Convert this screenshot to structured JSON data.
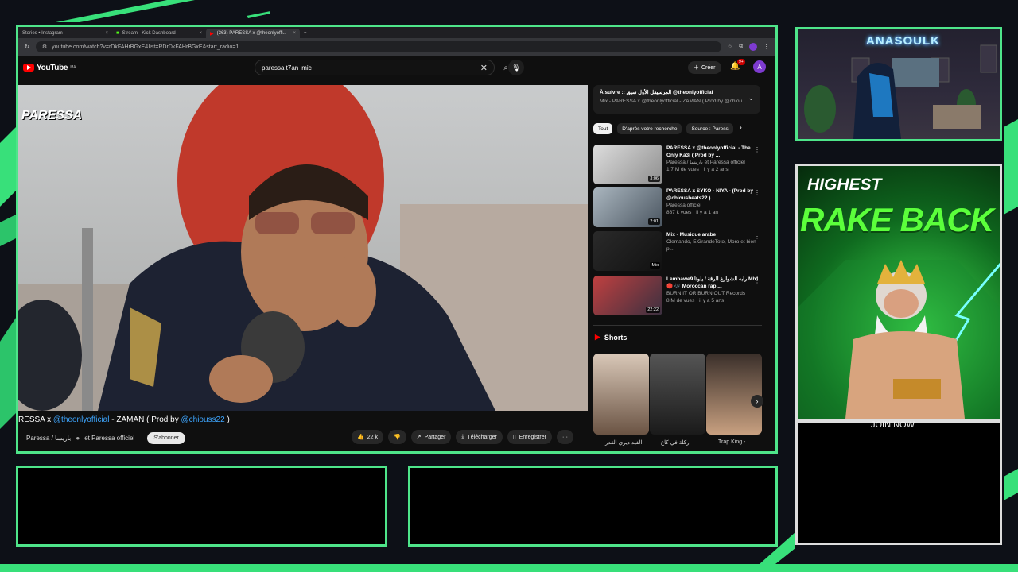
{
  "browser": {
    "tabs": [
      {
        "label": "Stories • Instagram"
      },
      {
        "label": "Stream - Kick Dashboard"
      },
      {
        "label": "(363) PARESSA x @theonlyoffi..."
      }
    ],
    "url": "youtube.com/watch?v=rDkFAHrBGxE&list=RDrDkFAHrBGxE&start_radio=1"
  },
  "youtube": {
    "logo": "YouTube",
    "logo_country": "MA",
    "search_value": "paressa  t7an lmic",
    "create_label": "Créer",
    "notif_count": "9+",
    "avatar_letter": "A",
    "video_title_pre": "RESSA x ",
    "video_title_link1": "@theonlyofficial",
    "video_title_mid": " - ZAMAN ( Prod by ",
    "video_title_link2": "@chiouss22",
    "video_title_post": " )",
    "channel": "Paressa / باريسا",
    "channel_and": "et Paressa officiel",
    "subscribe": "S'abonner",
    "likes": "22 k",
    "share": "Partager",
    "download": "Télécharger",
    "save": "Enregistrer",
    "watermark": "PARESSA",
    "up_next_title": "À suivre :: المرسيقل الأول سيق @theonlyofficial",
    "up_next_sub": "Mix - PARESSA x @theonlyofficial - ZAMAN ( Prod by @chiou...",
    "chips": [
      "Tout",
      "D'après votre recherche",
      "Source : Paress"
    ],
    "recommendations": [
      {
        "title": "PARESSA x @theonlyofficial - The Only Ka3i ( Prod by ...",
        "channel": "Paressa / باريسا  et Paressa officiel",
        "meta": "1,7 M de vues · il y a 2 ans",
        "duration": "3:06"
      },
      {
        "title": "PARESSA x SYKO - NIYA - (Prod by @chiousbeats22 )",
        "channel": "Paressa officiel",
        "meta": "887 k vues · il y a 1 an",
        "duration": "2:01"
      },
      {
        "title": "Mix - Musique arabe",
        "channel": "Clemando, ElGrandeToto, Moro et bien pl...",
        "meta": "",
        "duration": "Mix"
      },
      {
        "title": "Lembawe9 رابه الشوارع الرقة / يلوثا Mb1 🔴 🎶 Moroccan rap ...",
        "channel": "BURN IT OR BURN OUT Records",
        "meta": "8 M de vues · il y a 5 ans",
        "duration": "22:22"
      }
    ],
    "shorts_label": "Shorts",
    "shorts": [
      {
        "caption": "الفيد ديري القدر"
      },
      {
        "caption": "ركلة في كاع"
      },
      {
        "caption": "Trap King -"
      }
    ]
  },
  "overlay": {
    "streamer_name": "ANASOULK",
    "ad_line1": "HIGHEST",
    "ad_line2": "RAKE BACK",
    "join_label": "JOIN NOW"
  }
}
